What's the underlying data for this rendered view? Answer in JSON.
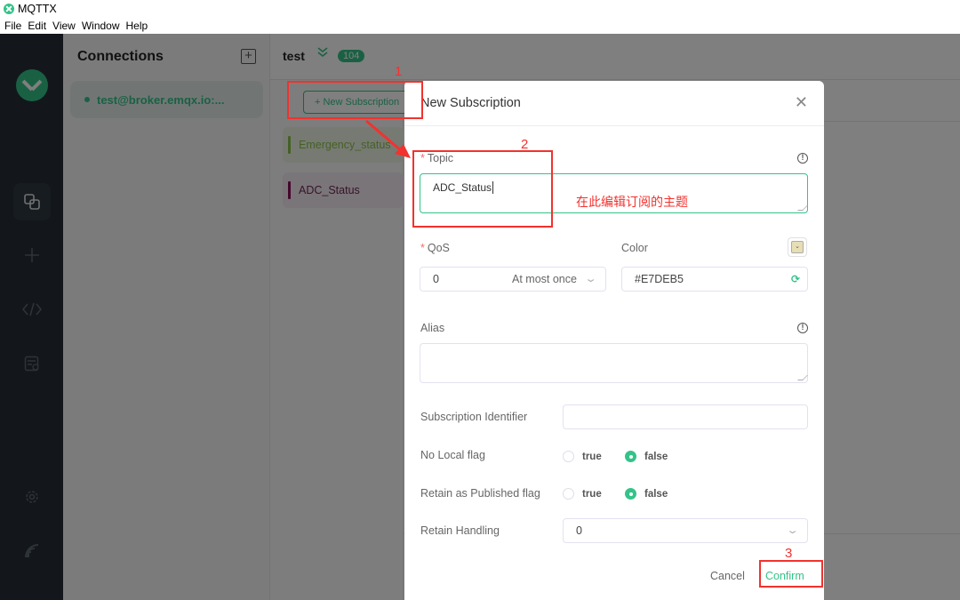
{
  "window": {
    "title": "MQTTX",
    "menu": [
      "File",
      "Edit",
      "View",
      "Window",
      "Help"
    ]
  },
  "sidebar": {
    "nav": [
      {
        "icon": "connections-icon",
        "glyph": "⧉",
        "active": true
      },
      {
        "icon": "plus-icon",
        "glyph": "+"
      },
      {
        "icon": "script-icon",
        "glyph": "</>"
      },
      {
        "icon": "log-icon",
        "glyph": "▤"
      },
      {
        "icon": "settings-icon",
        "glyph": "⚙"
      },
      {
        "icon": "subscribe-feed-icon",
        "glyph": "≋"
      }
    ]
  },
  "connections": {
    "title": "Connections",
    "items": [
      {
        "label": "test@broker.emqx.io:...",
        "status": "connected"
      }
    ]
  },
  "main": {
    "title": "test",
    "message_count": "104",
    "new_subscription_label": "+ New Subscription",
    "subscriptions": [
      {
        "topic": "Emergency_status",
        "color": "#8BC34A"
      },
      {
        "topic": "ADC_Status",
        "color": "#8B0F5B"
      }
    ]
  },
  "dialog": {
    "title": "New Subscription",
    "topic": {
      "label": "Topic",
      "value": "ADC_Status"
    },
    "qos": {
      "label": "QoS",
      "value": "0",
      "description": "At most once"
    },
    "color": {
      "label": "Color",
      "value": "#E7DEB5"
    },
    "alias": {
      "label": "Alias",
      "value": ""
    },
    "subscription_identifier": {
      "label": "Subscription Identifier",
      "value": ""
    },
    "no_local": {
      "label": "No Local flag",
      "options": [
        "true",
        "false"
      ],
      "selected": "false"
    },
    "retain_as_published": {
      "label": "Retain as Published flag",
      "options": [
        "true",
        "false"
      ],
      "selected": "false"
    },
    "retain_handling": {
      "label": "Retain Handling",
      "value": "0"
    },
    "cancel_label": "Cancel",
    "confirm_label": "Confirm"
  },
  "annotations": {
    "step1": "1",
    "step2": "2",
    "step3": "3",
    "topic_hint": "在此编辑订阅的主题",
    "color": "#F2322E"
  }
}
